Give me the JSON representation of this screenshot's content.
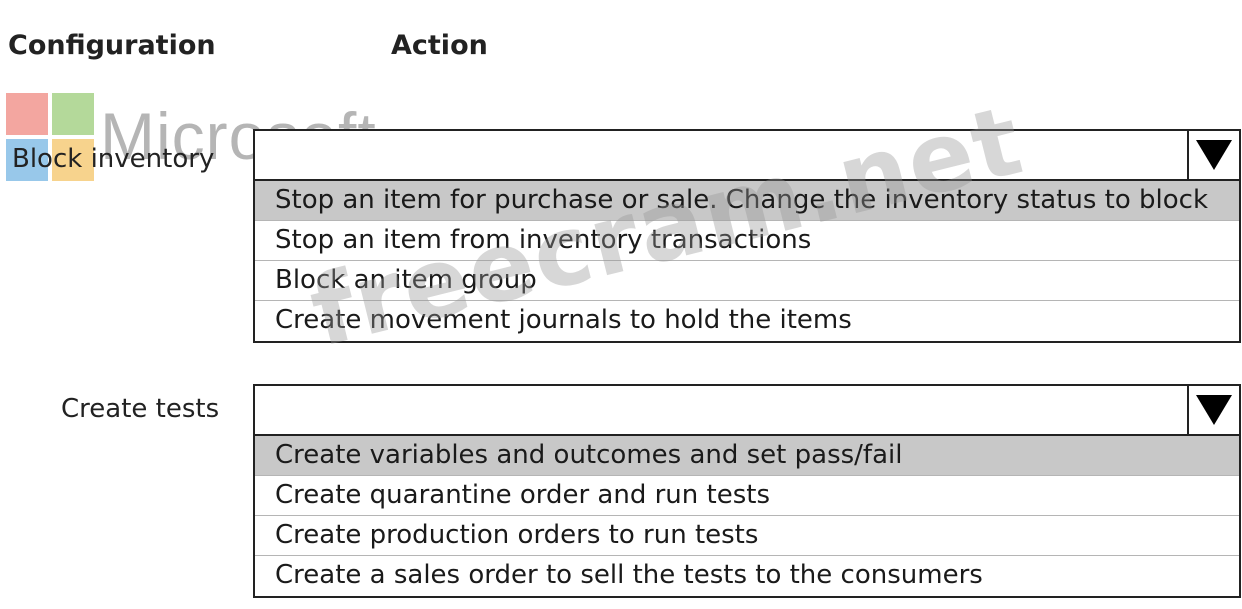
{
  "headers": {
    "configuration": "Configuration",
    "action": "Action"
  },
  "logo": {
    "wordmark": "Microsoft",
    "colors": [
      "#f3a6a0",
      "#b4d99a",
      "#98c8ea",
      "#f7d38d"
    ]
  },
  "watermark": "freecram.net",
  "rows": [
    {
      "label": "Block inventory",
      "selected_value": "",
      "dropdown_icon": "triangle-down-icon",
      "options": [
        "Stop an item for purchase or sale. Change the inventory status to block",
        "Stop an item from inventory transactions",
        "Block an item group",
        "Create movement journals to hold the items"
      ],
      "highlighted_index": 0
    },
    {
      "label": "Create tests",
      "selected_value": "",
      "dropdown_icon": "triangle-down-icon",
      "options": [
        "Create variables and outcomes and set pass/fail",
        "Create quarantine order and run tests",
        "Create production orders to run tests",
        "Create a sales order to sell the tests to the consumers"
      ],
      "highlighted_index": 0
    }
  ],
  "colors": {
    "highlight": "#c8c8c8",
    "border": "#222222"
  }
}
